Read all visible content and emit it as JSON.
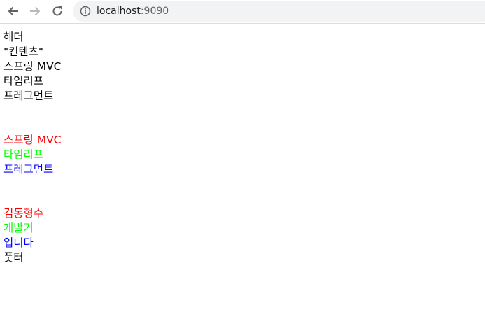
{
  "browser": {
    "url_host": "localhost",
    "url_port": ":9090",
    "back_icon": "arrow-left-icon",
    "forward_icon": "arrow-right-icon",
    "reload_icon": "reload-icon",
    "info_icon": "info-icon"
  },
  "page": {
    "header": "헤더",
    "content_quoted": "\"컨텐츠\"",
    "plain": {
      "spring": "스프링 MVC",
      "thymeleaf": "타임리프",
      "fragment": "프레그먼트"
    },
    "colored": {
      "spring": "스프링 MVC",
      "thymeleaf": "타임리프",
      "fragment": "프레그먼트"
    },
    "name_block": {
      "name": "김동형수",
      "developer": "개발기",
      "is": "입니다"
    },
    "footer": "풋터"
  },
  "colors": {
    "red": "#ff0000",
    "green": "#00ff00",
    "blue": "#0000ff",
    "black": "#000000"
  }
}
